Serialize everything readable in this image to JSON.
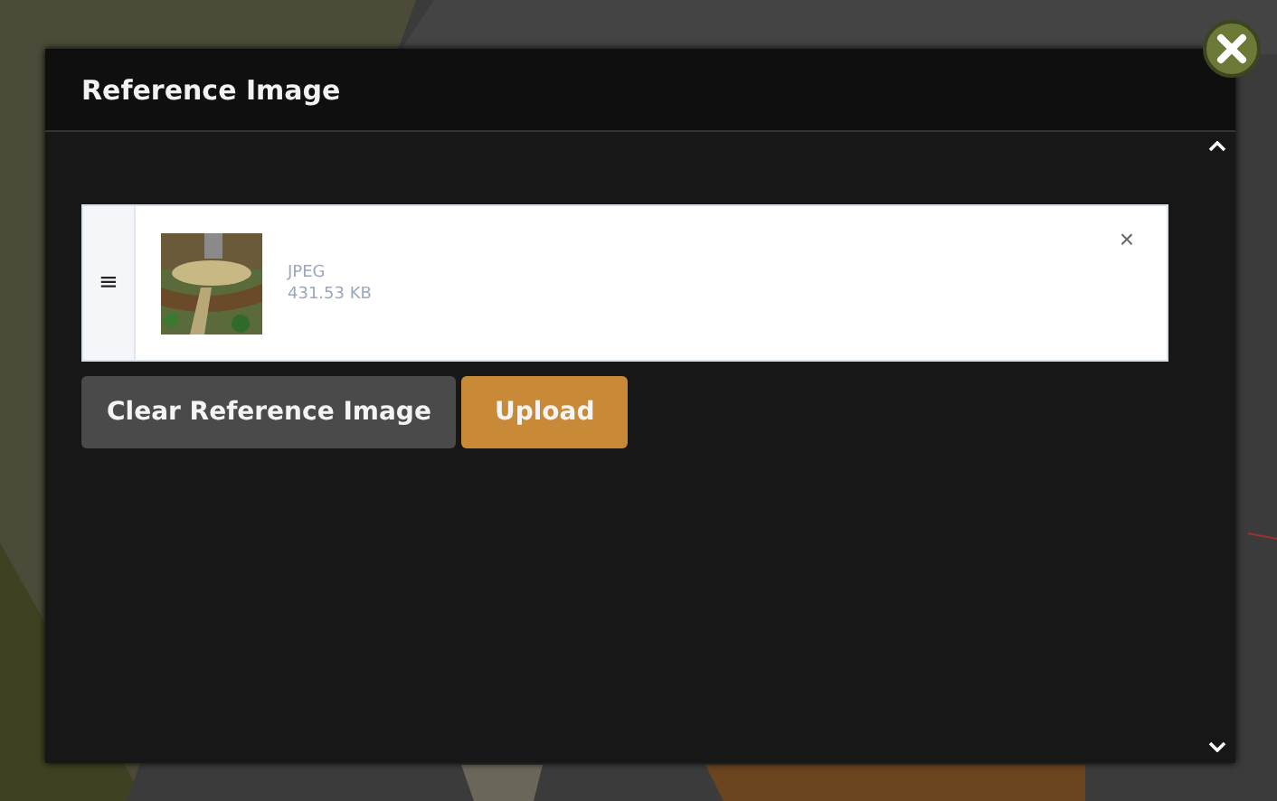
{
  "dialog": {
    "title": "Reference Image"
  },
  "file": {
    "handle": "≡",
    "type": "JPEG",
    "size": "431.53 KB",
    "remove": "×"
  },
  "buttons": [
    {
      "label": "Clear Reference Image",
      "kind": "secondary"
    },
    {
      "label": "Upload",
      "kind": "primary"
    }
  ]
}
